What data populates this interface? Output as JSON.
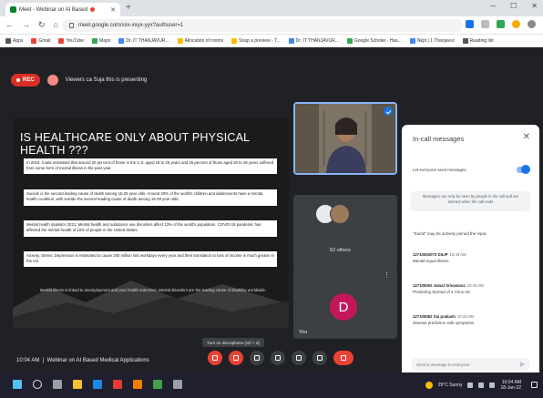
{
  "browser": {
    "tab_title": "Meet - Webinar on AI Based",
    "omnibox_url": "meet.google.com/xxx-xxyx-yyx?authuser=1",
    "bookmarks": [
      "Apps",
      "Gmail",
      "YouTube",
      "Maps",
      "Dr. IT THANJAVUR...",
      "Allocation of rooms",
      "Snap a preview - T...",
      "Dr. IT THANJAVUR...",
      "Google Scholar - Has...",
      "Nkpt | 1 Thanjavur",
      "Reading list"
    ]
  },
  "meet": {
    "rec_label": "REC",
    "presenting_text": "Viewers ca Suja this is presenting",
    "meeting_time": "10:04 AM",
    "meeting_title": "Webinar on AI Based Medical Applications",
    "tooltip": "Turn on microphone (ctrl + d)",
    "slide": {
      "title": "IS HEALTHCARE ONLY ABOUT PHYSICAL HEALTH ???",
      "paragraphs": [
        "In 2019, it was estimated that around 20 percent of those in the U.S. aged 18 to 25 years and 25 percent of those aged 26 to 49 years suffered from some form of mental illness in the past year.",
        "Suicide is the second leading cause of death among 15-29 year olds. Around 20% of the world's children and adolescents have a mental health condition, with suicide the second leading cause of death among 15-29 year olds.",
        "Mental health statistics 2021: Mental health and substance use disorders affect 13% of the world's population. COVID-19 pandemic has affected the mental health of 10% of people in the United States.",
        "Anxiety, Stress, Depression is estimated to cause 200 million lost workdays every year and their translation to loss of income is much greater in the US."
      ],
      "footer": "Mental illness is linked to unemployment and poor health outcomes. Mental disorders are the leading cause of disability worldwide."
    },
    "tiles": {
      "others_count": "62 others",
      "you_label": "You",
      "avatar_letter": "D"
    }
  },
  "chat": {
    "title": "In-call messages",
    "toggle_label": "Let everyone send messages",
    "notice": "Messages can only be seen by people in the call and are deleted when the call ends",
    "pinned_note": "\"Sumit\" may be actively pinned the input.",
    "messages": [
      {
        "sender": "12710502073 DILIP",
        "time": "10:43 AM",
        "text": "Mental equal illness"
      },
      {
        "sender": "127105002 Jainal Srivastava",
        "time": "10:43 AM",
        "text": "Predicting Spread of a Virus etc"
      },
      {
        "sender": "127105062 Sai prakash",
        "time": "10:43 AM",
        "text": "disease prediction with symptoms"
      }
    ],
    "composer_placeholder": "Send a message to everyone"
  },
  "taskbar": {
    "weather": "29°C Sunny",
    "time": "10:04 AM",
    "date": "18-Jan-22"
  },
  "colors": {
    "meet_bg": "#202124",
    "accent": "#1a73e8",
    "hangup": "#ea4335",
    "avatar_d": "#c2185b"
  }
}
